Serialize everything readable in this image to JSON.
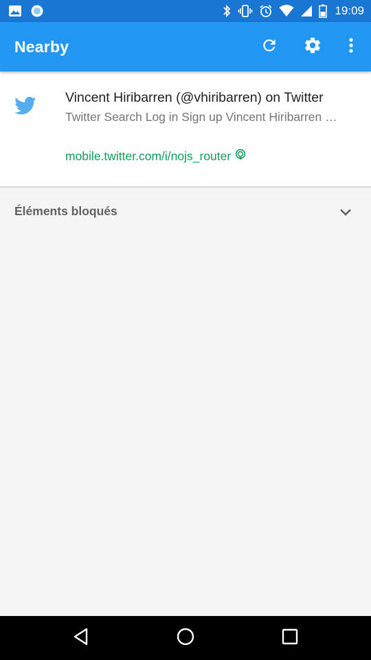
{
  "status_bar": {
    "time": "19:09",
    "left_icons": [
      "image-icon",
      "record-icon"
    ],
    "right_icons": [
      "bluetooth-icon",
      "vibrate-icon",
      "alarm-icon",
      "wifi-icon",
      "signal-icon",
      "battery-icon"
    ]
  },
  "app_bar": {
    "title": "Nearby",
    "actions": [
      "refresh-icon",
      "gear-icon",
      "more-vert-icon"
    ]
  },
  "nearby_items": [
    {
      "title": "Vincent Hiribarren (@vhiribarren) on Twitter",
      "snippet": "Twitter Search Log in Sign up Vincent Hiribarren …",
      "url": "mobile.twitter.com/i/nojs_router",
      "icon": "twitter-bird-icon",
      "beacon_icon": "beacon-icon"
    }
  ],
  "blocked_section": {
    "label": "Éléments bloqués",
    "icon": "chevron-down-icon"
  },
  "navigation_bar": {
    "buttons": [
      "back-icon",
      "home-icon",
      "recents-icon"
    ]
  },
  "colors": {
    "status_bar": "#1976D2",
    "app_bar": "#2196F3",
    "url_green": "#0F9D58",
    "twitter_blue": "#55ACEE",
    "background": "#F5F5F5"
  }
}
